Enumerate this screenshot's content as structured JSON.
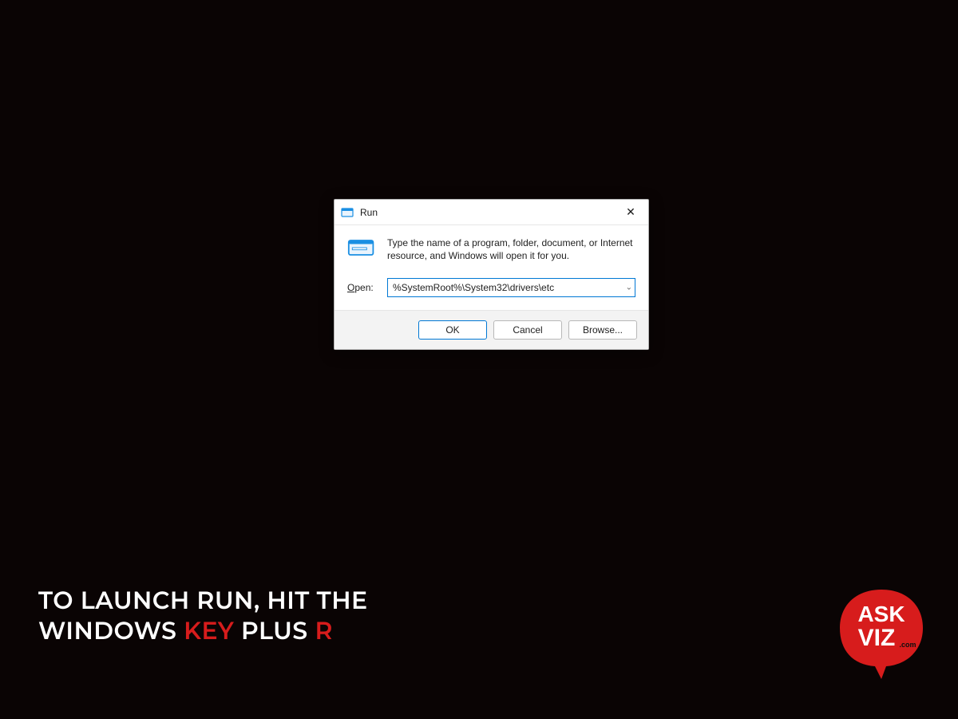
{
  "dialog": {
    "title": "Run",
    "description": "Type the name of a program, folder, document, or Internet resource, and Windows will open it for you.",
    "open_label_prefix": "O",
    "open_label_rest": "pen:",
    "open_value": "%SystemRoot%\\System32\\drivers\\etc",
    "buttons": {
      "ok": "OK",
      "cancel": "Cancel",
      "browse": "Browse..."
    },
    "icons": {
      "app": "run-app-icon",
      "close": "close-icon",
      "run_large": "run-large-icon",
      "chevron": "chevron-down-icon"
    }
  },
  "caption": {
    "seg1": "TO LAUNCH RUN, HIT THE",
    "seg2a": "WINDOWS ",
    "seg2b": "KEY",
    "seg2c": " PLUS ",
    "seg2d": "R"
  },
  "brand": {
    "line1": "ASK",
    "line2": "VIZ",
    "dotcom": ".com"
  },
  "colors": {
    "accent_red": "#d71c1c",
    "win_blue": "#0078d4"
  }
}
